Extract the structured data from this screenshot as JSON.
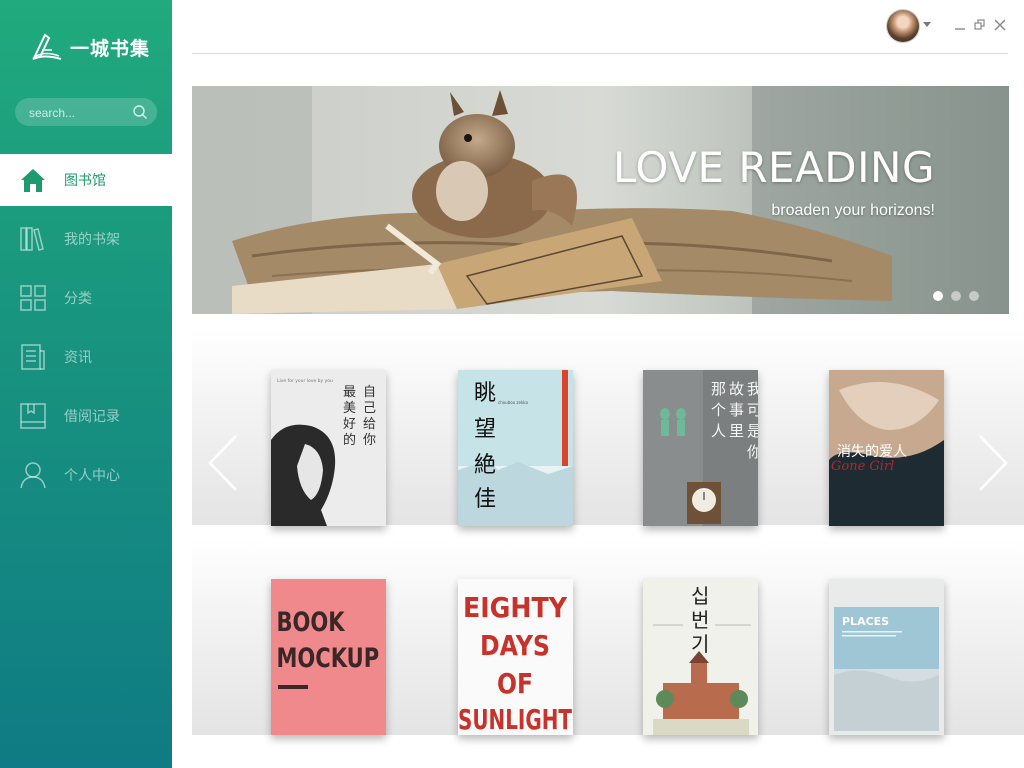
{
  "app": {
    "name": "一城书集"
  },
  "search": {
    "placeholder": "search..."
  },
  "nav": [
    {
      "label": "图书馆",
      "icon": "home-icon",
      "active": true
    },
    {
      "label": "我的书架",
      "icon": "bookshelf-icon"
    },
    {
      "label": "分类",
      "icon": "grid-icon"
    },
    {
      "label": "资讯",
      "icon": "news-icon"
    },
    {
      "label": "借阅记录",
      "icon": "book-record-icon"
    },
    {
      "label": "个人中心",
      "icon": "user-icon"
    }
  ],
  "window": {
    "controls": [
      "minimize",
      "restore",
      "close"
    ]
  },
  "banner": {
    "title": "LOVE READING",
    "subtitle": "broaden your horizons!",
    "slides": 3,
    "active_slide": 1
  },
  "books_row1": [
    {
      "title": "最美好的自己给你",
      "cover": "girl-portrait",
      "top_text": "Live for your love by you"
    },
    {
      "title": "眺望絶佳",
      "cover": "snow-city-tower",
      "subtitle": "chouboo zekka"
    },
    {
      "title": "那个故事里是我可是你",
      "cover": "grey-wall-clock"
    },
    {
      "title": "消失的爱人",
      "cover": "blonde-woman",
      "en_title": "Gone Girl"
    }
  ],
  "books_row2": [
    {
      "title": "BOOK MOCKUP",
      "cover": "pink"
    },
    {
      "title": "EIGHTY DAYS OF SUNLIGHT",
      "cover": "red-text"
    },
    {
      "title": "십번기",
      "cover": "korean-building"
    },
    {
      "title": "PLACES",
      "cover": "beach"
    }
  ],
  "colors": {
    "accent": "#21aa7d",
    "sidebar_bottom": "#0f7b84"
  }
}
